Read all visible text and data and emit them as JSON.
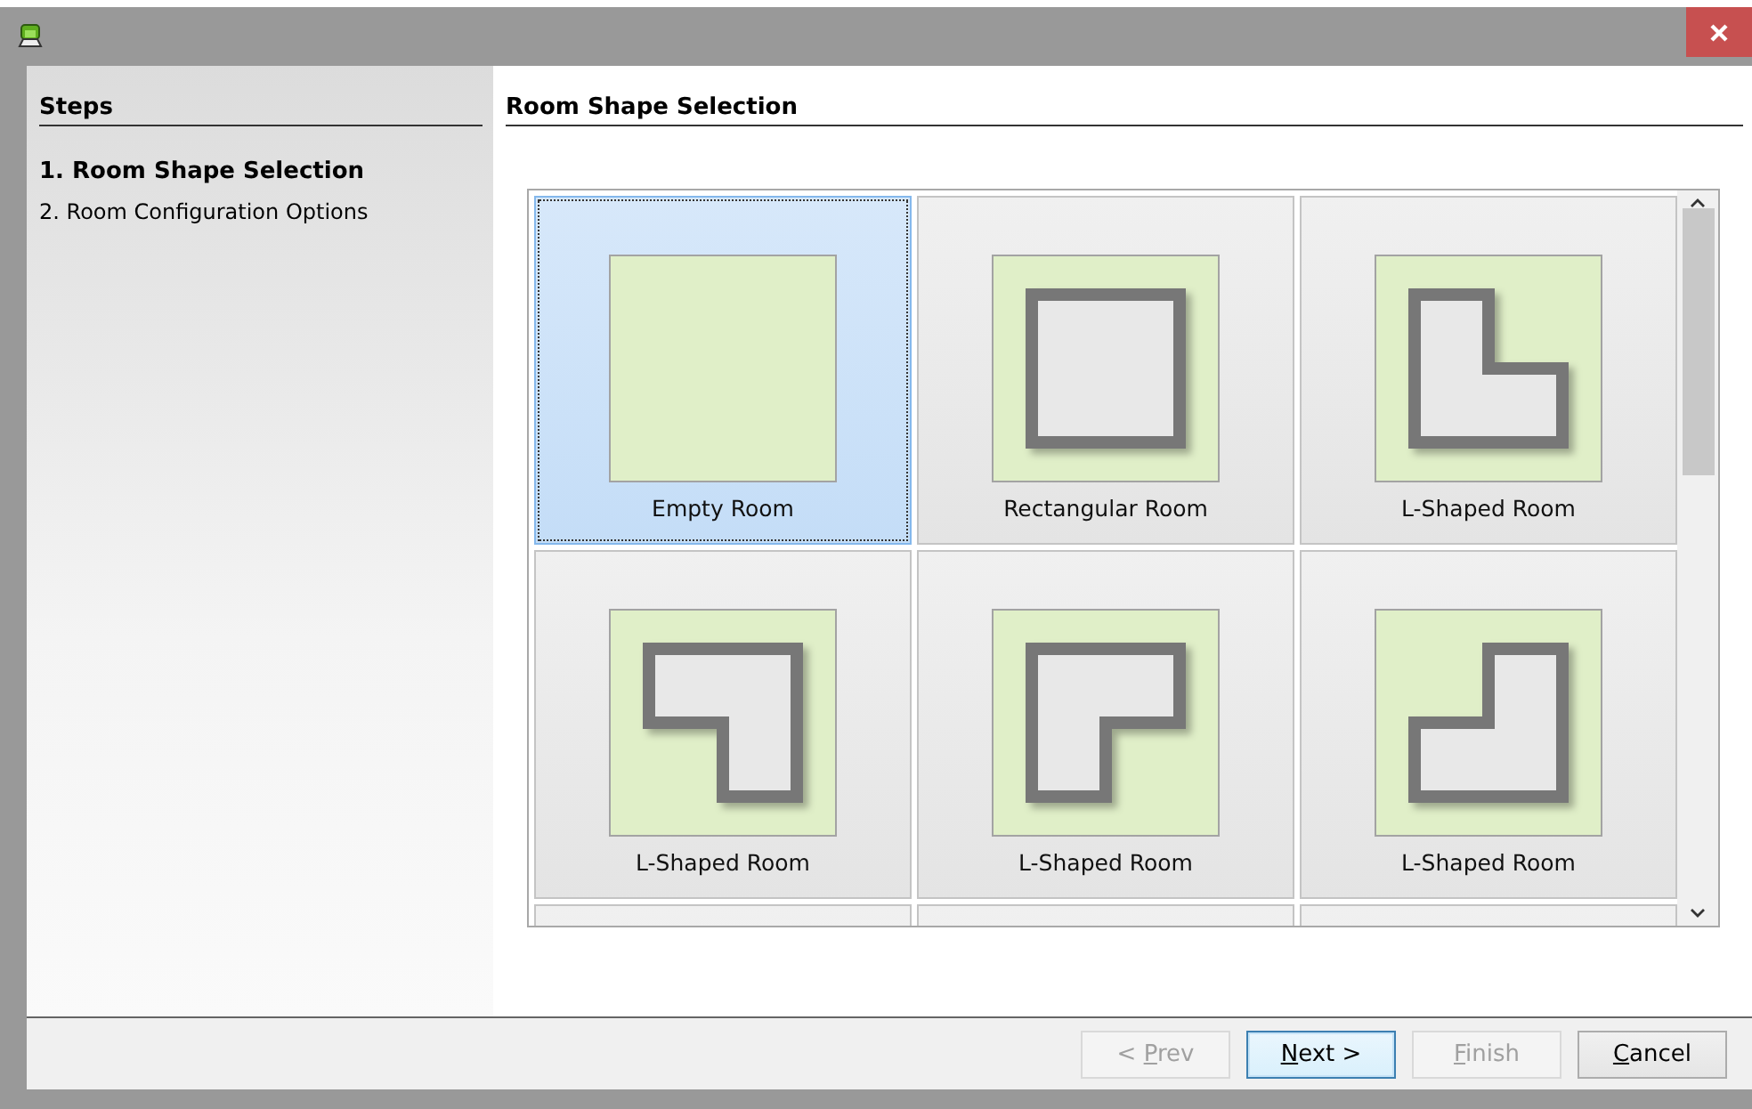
{
  "steps": {
    "title": "Steps",
    "items": [
      {
        "label": "1. Room Shape Selection",
        "selected": true
      },
      {
        "label": "2. Room Configuration Options",
        "selected": false
      }
    ]
  },
  "panel": {
    "title": "Room Shape Selection"
  },
  "tiles": [
    {
      "kind": "empty",
      "label": "Empty Room",
      "selected": true
    },
    {
      "kind": "rectangle",
      "label": "Rectangular Room",
      "selected": false
    },
    {
      "kind": "l-ne",
      "label": "L-Shaped Room",
      "selected": false
    },
    {
      "kind": "l-sw",
      "label": "L-Shaped Room",
      "selected": false
    },
    {
      "kind": "l-se",
      "label": "L-Shaped Room",
      "selected": false
    },
    {
      "kind": "l-nw",
      "label": "L-Shaped Room",
      "selected": false
    },
    {
      "kind": "cut",
      "selected": false
    },
    {
      "kind": "cut",
      "selected": false
    },
    {
      "kind": "cut",
      "selected": false
    }
  ],
  "buttons": [
    {
      "before": "< ",
      "key": "P",
      "after": "rev",
      "disabled": true,
      "default": false
    },
    {
      "key": "N",
      "after": "ext >",
      "disabled": false,
      "default": true
    },
    {
      "key": "F",
      "after": "inish",
      "disabled": true,
      "default": false
    },
    {
      "key": "C",
      "after": "ancel",
      "disabled": false,
      "default": false
    }
  ]
}
